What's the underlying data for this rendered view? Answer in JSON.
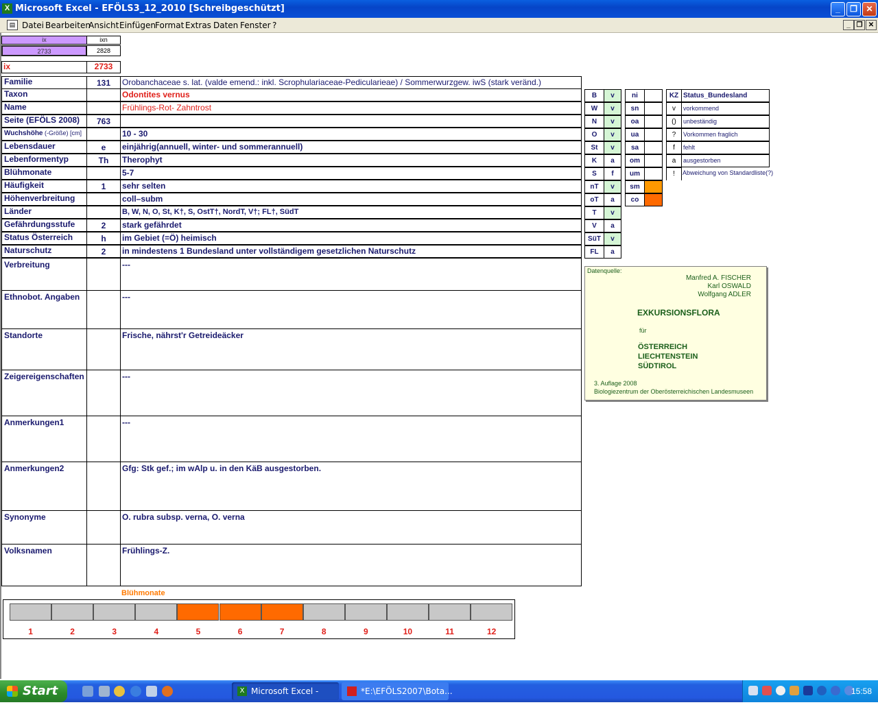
{
  "window": {
    "title": "Microsoft Excel - EFÖLS3_12_2010  [Schreibgeschützt]",
    "app_icon": "excel-icon"
  },
  "menu": [
    "Datei",
    "Bearbeiten",
    "Ansicht",
    "Einfügen",
    "Format",
    "Extras",
    "Daten",
    "Fenster",
    "?"
  ],
  "index": {
    "ix_header": "ix",
    "ixn_header": "ixn",
    "ix_value": "2733",
    "ixn_value": "2828",
    "ix_label": "ix",
    "ix_big": "2733"
  },
  "fields": [
    {
      "label": "Familie",
      "code": "131",
      "value": "Orobanchaceae s. lat. (valde emend.: inkl. Scrophulariaceae-Pedicularieae)  /  Sommerwurzgew. iwS (stark veränd.)"
    },
    {
      "label": "Taxon",
      "code": "",
      "value": "Odontites vernus"
    },
    {
      "label": "Name",
      "code": "",
      "value": "Frühlings-Rot- Zahntrost"
    },
    {
      "label": "Seite (EFÖLS 2008)",
      "code": "763",
      "value": ""
    },
    {
      "label": "Wuchshöhe",
      "label_suffix": "(-Größe) [cm]",
      "code": "",
      "value": "10 - 30"
    },
    {
      "label": "Lebensdauer",
      "code": "e",
      "value": "einjährig(annuell, winter- und sommerannuell)"
    },
    {
      "label": "Lebenformentyp",
      "code": "Th",
      "value": "Therophyt"
    },
    {
      "label": "Blühmonate",
      "code": "",
      "value": "5-7"
    },
    {
      "label": "Häufigkeit",
      "code": "1",
      "value": "sehr selten"
    },
    {
      "label": "Höhenverbreitung",
      "code": "",
      "value": "coll–subm"
    },
    {
      "label": "Länder",
      "code": "",
      "value": "B, W, N, O, St, K†, S, OstT†, NordT, V†; FL†, SüdT"
    },
    {
      "label": "Gefährdungsstufe",
      "code": "2",
      "value": "stark gefährdet"
    },
    {
      "label": "Status Österreich",
      "code": "h",
      "value": "im Gebiet (=Ö) heimisch"
    },
    {
      "label": "Naturschutz",
      "code": "2",
      "value": "in mindestens 1 Bundesland unter vollständigem gesetzlichen Naturschutz"
    }
  ],
  "text_fields": [
    {
      "label": "Verbreitung",
      "value": "---"
    },
    {
      "label": "Ethnobot. Angaben",
      "value": "---"
    },
    {
      "label": "Standorte",
      "value": "Frische, nährst'r Getreideäcker"
    },
    {
      "label": "Zeigereigenschaften",
      "value": "---"
    },
    {
      "label": "Anmerkungen1",
      "value": "---"
    },
    {
      "label": "Anmerkungen2",
      "value": "Gfg: Stk gef.; im wAlp u. in den KäB ausgestorben."
    },
    {
      "label": "Synonyme",
      "value": "O. rubra subsp. verna, O. verna"
    },
    {
      "label": "Volksnamen",
      "value": "Frühlings-Z."
    }
  ],
  "states": [
    {
      "code": "B",
      "status": "v"
    },
    {
      "code": "W",
      "status": "v"
    },
    {
      "code": "N",
      "status": "v"
    },
    {
      "code": "O",
      "status": "v"
    },
    {
      "code": "St",
      "status": "v"
    },
    {
      "code": "K",
      "status": "a"
    },
    {
      "code": "S",
      "status": "f"
    },
    {
      "code": "nT",
      "status": "v"
    },
    {
      "code": "oT",
      "status": "a"
    },
    {
      "code": "T",
      "status": "v"
    },
    {
      "code": "V",
      "status": "a"
    },
    {
      "code": "SüT",
      "status": "v"
    },
    {
      "code": "FL",
      "status": "a"
    }
  ],
  "zones": [
    {
      "code": "ni",
      "highlight": false
    },
    {
      "code": "sn",
      "highlight": false
    },
    {
      "code": "oa",
      "highlight": false
    },
    {
      "code": "ua",
      "highlight": false
    },
    {
      "code": "sa",
      "highlight": false
    },
    {
      "code": "om",
      "highlight": false
    },
    {
      "code": "um",
      "highlight": false
    },
    {
      "code": "sm",
      "highlight": true
    },
    {
      "code": "co",
      "highlight": true
    }
  ],
  "legend": {
    "kz_header": "KZ",
    "status_header": "Status_Bundesland",
    "rows": [
      {
        "kz": "v",
        "text": "vorkommend"
      },
      {
        "kz": "()",
        "text": "unbeständig"
      },
      {
        "kz": "?",
        "text": "Vorkommen fraglich"
      },
      {
        "kz": "f",
        "text": "fehlt"
      },
      {
        "kz": "a",
        "text": "ausgestorben"
      },
      {
        "kz": "!",
        "text": "Abweichung von Standardliste(?)"
      }
    ]
  },
  "source": {
    "label": "Datenquelle:",
    "authors": [
      "Manfred A. FISCHER",
      "Karl OSWALD",
      "Wolfgang ADLER"
    ],
    "title": "EXKURSIONSFLORA",
    "fuer": "für",
    "regions": [
      "ÖSTERREICH",
      "LIECHTENSTEIN",
      "SÜDTIROL"
    ],
    "edition": "3. Auflage 2008",
    "publisher": "Biologiezentrum der Oberösterreichischen Landesmuseen"
  },
  "bloom": {
    "title": "Blühmonate",
    "months": [
      "1",
      "2",
      "3",
      "4",
      "5",
      "6",
      "7",
      "8",
      "9",
      "10",
      "11",
      "12"
    ],
    "active": [
      5,
      6,
      7
    ],
    "active_color": "#ff6a00",
    "inactive_color": "#c8c8c8"
  },
  "taskbar": {
    "start": "Start",
    "tasks": [
      "Microsoft Excel - EFÖ...",
      "*E:\\EFÖLS2007\\Bota..."
    ],
    "clock": "15:58"
  }
}
